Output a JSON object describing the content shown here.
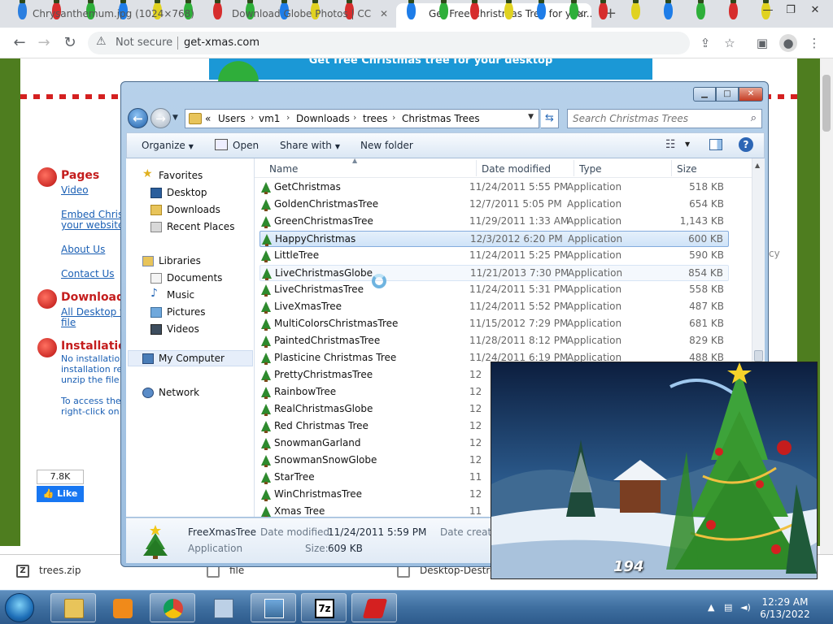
{
  "browser": {
    "tabs": [
      {
        "label": "Chrysanthemum.jpg (1024×768)"
      },
      {
        "label": "Download Globe Photos | CC"
      },
      {
        "label": "Get Free Christmas Tree for your..."
      }
    ],
    "tab_close_glyph": "✕",
    "new_tab_glyph": "+",
    "security_label": "Not secure",
    "url": "get-xmas.com"
  },
  "site": {
    "banner": "Get free Christmas tree for your desktop",
    "sections": [
      {
        "heading": "Pages",
        "links": [
          "Video",
          "Embed Christ",
          "your website",
          "About Us",
          "Contact Us"
        ]
      },
      {
        "heading": "Download",
        "links": [
          "All Desktop t",
          "file"
        ]
      },
      {
        "heading": "Installation",
        "text": [
          "No installatio",
          "installation re",
          "unzip the file",
          "To access the",
          "right-click on"
        ]
      }
    ],
    "right_fragment": "cy",
    "like_count": "7.8K",
    "like_label": "Like"
  },
  "downloads": [
    {
      "name": "trees.zip",
      "icon": "zip-icon",
      "icon_glyph": "Z"
    },
    {
      "name": "file",
      "icon": "file-icon",
      "icon_glyph": ""
    },
    {
      "name": "Desktop-Destro",
      "icon": "file-icon",
      "icon_glyph": ""
    }
  ],
  "explorer": {
    "address": {
      "overflow": "«",
      "crumbs": [
        "Users",
        "vm1",
        "Downloads",
        "trees",
        "Christmas Trees"
      ]
    },
    "search_placeholder": "Search Christmas Trees",
    "commands": {
      "organize": "Organize",
      "open": "Open",
      "share_with": "Share with",
      "new_folder": "New folder",
      "help": "?"
    },
    "nav": {
      "favorites": "Favorites",
      "desktop": "Desktop",
      "downloads": "Downloads",
      "recent": "Recent Places",
      "libraries": "Libraries",
      "documents": "Documents",
      "music": "Music",
      "pictures": "Pictures",
      "videos": "Videos",
      "my_computer": "My Computer",
      "network": "Network"
    },
    "columns": {
      "name": "Name",
      "date": "Date modified",
      "type": "Type",
      "size": "Size"
    },
    "files": [
      {
        "name": "GetChristmas",
        "date": "11/24/2011 5:55 PM",
        "type": "Application",
        "size": "518 KB"
      },
      {
        "name": "GoldenChristmasTree",
        "date": "12/7/2011 5:05 PM",
        "type": "Application",
        "size": "654 KB"
      },
      {
        "name": "GreenChristmasTree",
        "date": "11/29/2011 1:33 AM",
        "type": "Application",
        "size": "1,143 KB"
      },
      {
        "name": "HappyChristmas",
        "date": "12/3/2012 6:20 PM",
        "type": "Application",
        "size": "600 KB"
      },
      {
        "name": "LittleTree",
        "date": "11/24/2011 5:25 PM",
        "type": "Application",
        "size": "590 KB"
      },
      {
        "name": "LiveChristmasGlobe",
        "date": "11/21/2013 7:30 PM",
        "type": "Application",
        "size": "854 KB"
      },
      {
        "name": "LiveChristmasTree",
        "date": "11/24/2011 5:31 PM",
        "type": "Application",
        "size": "558 KB"
      },
      {
        "name": "LiveXmasTree",
        "date": "11/24/2011 5:52 PM",
        "type": "Application",
        "size": "487 KB"
      },
      {
        "name": "MultiColorsChristmasTree",
        "date": "11/15/2012 7:29 PM",
        "type": "Application",
        "size": "681 KB"
      },
      {
        "name": "PaintedChristmasTree",
        "date": "11/28/2011 8:12 PM",
        "type": "Application",
        "size": "829 KB"
      },
      {
        "name": "Plasticine Christmas Tree",
        "date": "11/24/2011 6:19 PM",
        "type": "Application",
        "size": "488 KB"
      },
      {
        "name": "PrettyChristmasTree",
        "date": "12",
        "type": "",
        "size": ""
      },
      {
        "name": "RainbowTree",
        "date": "12",
        "type": "",
        "size": ""
      },
      {
        "name": "RealChristmasGlobe",
        "date": "12",
        "type": "",
        "size": ""
      },
      {
        "name": "Red Christmas Tree",
        "date": "12",
        "type": "",
        "size": ""
      },
      {
        "name": "SnowmanGarland",
        "date": "12",
        "type": "",
        "size": ""
      },
      {
        "name": "SnowmanSnowGlobe",
        "date": "12",
        "type": "",
        "size": ""
      },
      {
        "name": "StarTree",
        "date": "11",
        "type": "",
        "size": ""
      },
      {
        "name": "WinChristmasTree",
        "date": "12",
        "type": "",
        "size": ""
      },
      {
        "name": "Xmas Tree",
        "date": "11",
        "type": "",
        "size": ""
      }
    ],
    "selected_index": 3,
    "hover_index": 5,
    "details": {
      "name": "FreeXmasTree",
      "type": "Application",
      "date_label": "Date modified:",
      "date_value": "11/24/2011 5:59 PM",
      "size_label": "Size:",
      "size_value": "609 KB",
      "created_label": "Date created"
    }
  },
  "preview": {
    "counter": "194"
  },
  "taskbar": {
    "clock_time": "12:29 AM",
    "clock_date": "6/13/2022",
    "apps": [
      "explorer-icon",
      "media-player-icon",
      "chrome-icon",
      "keyboard-icon",
      "picture-icon",
      "7zip-icon",
      "xmas-app-icon"
    ],
    "sevenzip_label": "7z"
  },
  "colors": {
    "site_green": "#4e7d1f",
    "link_blue": "#1a5fb4",
    "heading_red": "#c41d1d",
    "banner_blue": "#1b98d6"
  }
}
